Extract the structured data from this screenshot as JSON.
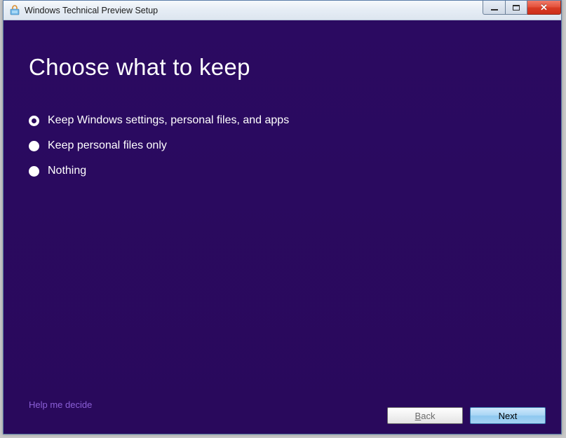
{
  "window": {
    "title": "Windows Technical Preview Setup"
  },
  "main": {
    "heading": "Choose what to keep",
    "options": [
      {
        "label": "Keep Windows settings, personal files, and apps",
        "selected": true
      },
      {
        "label": "Keep personal files only",
        "selected": false
      },
      {
        "label": "Nothing",
        "selected": false
      }
    ],
    "help_link": "Help me decide"
  },
  "footer": {
    "back_label": "Back",
    "next_label": "Next"
  }
}
